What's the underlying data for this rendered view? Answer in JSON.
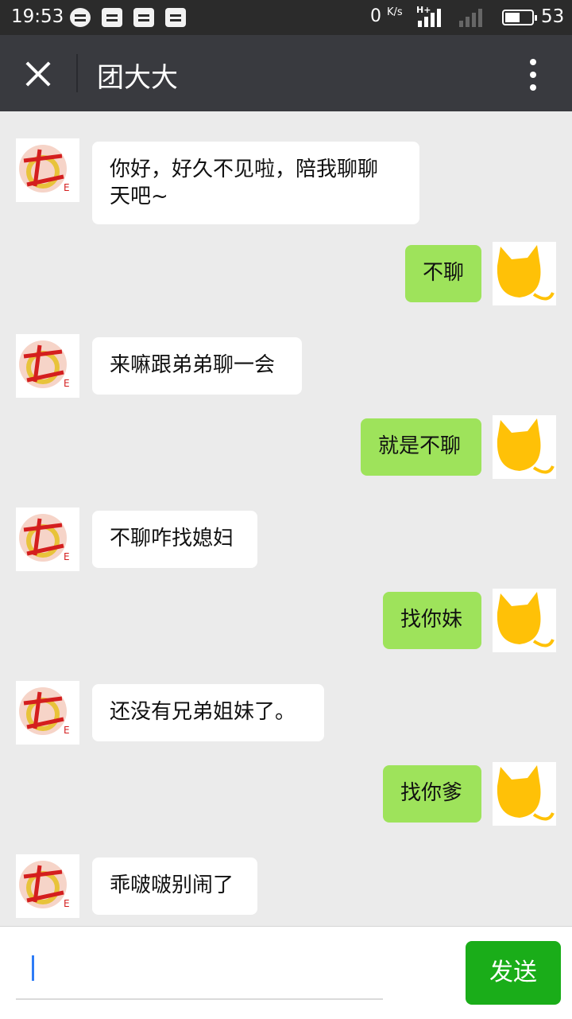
{
  "status_bar": {
    "time": "19:53",
    "net_speed": "0",
    "net_unit": "K/s",
    "network_type": "H+",
    "battery": "53"
  },
  "header": {
    "title": "团大大"
  },
  "messages": [
    {
      "side": "left",
      "text": "你好，好久不见啦，陪我聊聊\n天吧~"
    },
    {
      "side": "right",
      "text": "不聊"
    },
    {
      "side": "left",
      "text": "来嘛跟弟弟聊一会"
    },
    {
      "side": "right",
      "text": "就是不聊"
    },
    {
      "side": "left",
      "text": "不聊咋找媳妇"
    },
    {
      "side": "right",
      "text": "找你妹"
    },
    {
      "side": "left",
      "text": "还没有兄弟姐妹了。"
    },
    {
      "side": "right",
      "text": "找你爹"
    },
    {
      "side": "left",
      "text": "乖啵啵别闹了"
    }
  ],
  "composer": {
    "send_label": "发送",
    "input_value": ""
  },
  "colors": {
    "self_bubble": "#9ee35b",
    "send_button": "#1aad19",
    "titlebar": "#393a3f"
  }
}
